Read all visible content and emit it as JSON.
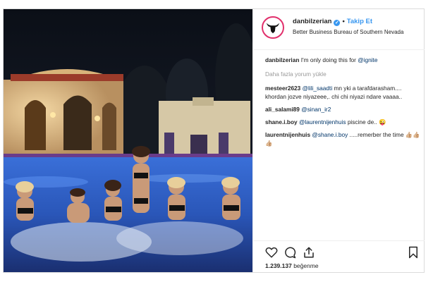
{
  "post": {
    "username": "danbilzerian",
    "follow_label": "Takip Et",
    "location": "Better Business Bureau of Southern Nevada"
  },
  "comments": {
    "caption": {
      "user": "danbilzerian",
      "text": "I'm only doing this for ",
      "mention": "@ignite"
    },
    "load_more": "Daha fazla yorum yükle",
    "items": [
      {
        "user": "mesteer2623",
        "mention": "@lili_saadti",
        "text": " mn yki a tarafdarasham.... khordan jozve niyazeee,. chi chi niyazi ndare vaaaa..",
        "emoji": ""
      },
      {
        "user": "ali_salami89",
        "mention": "@sinan_ir2",
        "text": "",
        "emoji": ""
      },
      {
        "user": "shane.i.boy",
        "mention": "@laurentnijenhuis",
        "text": " piscine de..",
        "emoji": "😜"
      },
      {
        "user": "laurentnijenhuis",
        "mention": "@shane.i.boy",
        "text": " .....remerber the time",
        "emoji": "👍🏼👍🏼👍🏼"
      }
    ]
  },
  "actions": {
    "likes_count": "1.239.137",
    "likes_label": "beğenme"
  },
  "icons": {
    "avatar": "bull-skull-logo-icon",
    "verified": "verified-badge-icon",
    "like": "heart-icon",
    "comment": "comment-bubble-icon",
    "share": "share-upload-icon",
    "save": "bookmark-icon"
  },
  "colors": {
    "link_blue": "#3897f0",
    "mention_blue": "#003569",
    "muted": "#999999",
    "border": "#dbdbdb"
  }
}
